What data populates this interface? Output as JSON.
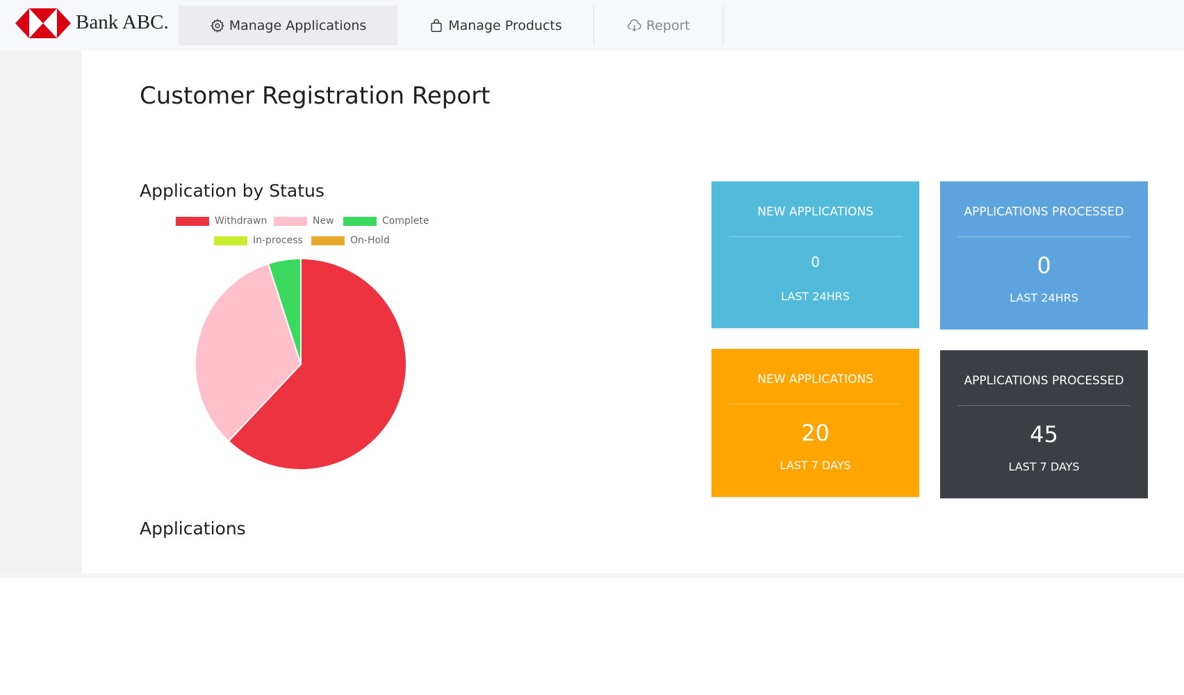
{
  "brand": {
    "name": "Bank ABC."
  },
  "nav": [
    {
      "label": "Manage Applications",
      "icon": "gear-icon"
    },
    {
      "label": "Manage Products",
      "icon": "shopping-bag-icon"
    },
    {
      "label": "Report",
      "icon": "cloud-download-icon"
    }
  ],
  "page": {
    "title": "Customer Registration Report"
  },
  "sections": {
    "status_title": "Application by Status",
    "applications_title": "Applications"
  },
  "colors": {
    "withdrawn": "#ee3340",
    "new": "#ffc0cb",
    "complete": "#3cd960",
    "in_process": "#c8ec30",
    "on_hold": "#e6a92c"
  },
  "chart_data": {
    "type": "pie",
    "categories": [
      "Withdrawn",
      "New",
      "Complete",
      "In-process",
      "On-Hold"
    ],
    "values": [
      62,
      33,
      5,
      0,
      0
    ],
    "colors": [
      "#ee3340",
      "#ffc0cb",
      "#3cd960",
      "#c8ec30",
      "#e6a92c"
    ],
    "legend_position": "top"
  },
  "cards": [
    {
      "title": "NEW APPLICATIONS",
      "value": "0",
      "period": "LAST 24HRS",
      "color": "#52bbdc"
    },
    {
      "title": "APPLICATIONS PROCESSED",
      "value": "0",
      "period": "LAST 24HRS",
      "color": "#5da4df"
    },
    {
      "title": "NEW APPLICATIONS",
      "value": "20",
      "period": "LAST 7 DAYS",
      "color": "#ffa502"
    },
    {
      "title": "APPLICATIONS PROCESSED",
      "value": "45",
      "period": "LAST 7 DAYS",
      "color": "#3b3e43"
    }
  ]
}
